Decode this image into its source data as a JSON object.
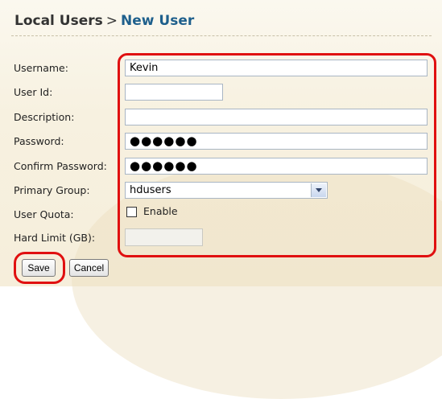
{
  "header": {
    "root": "Local Users",
    "separator": ">",
    "current": "New User"
  },
  "form": {
    "username": {
      "label": "Username:",
      "value": "Kevin"
    },
    "user_id": {
      "label": "User Id:",
      "value": ""
    },
    "description": {
      "label": "Description:",
      "value": ""
    },
    "password": {
      "label": "Password:",
      "value": "●●●●●●"
    },
    "confirm_password": {
      "label": "Confirm Password:",
      "value": "●●●●●●"
    },
    "primary_group": {
      "label": "Primary Group:",
      "value": "hdusers"
    },
    "user_quota": {
      "label": "User Quota:",
      "checkbox_label": "Enable",
      "checked": false
    },
    "hard_limit": {
      "label": "Hard Limit (GB):",
      "value": ""
    }
  },
  "buttons": {
    "save": "Save",
    "cancel": "Cancel"
  },
  "colors": {
    "highlight": "#e01010",
    "header_link": "#1e5f8c"
  }
}
